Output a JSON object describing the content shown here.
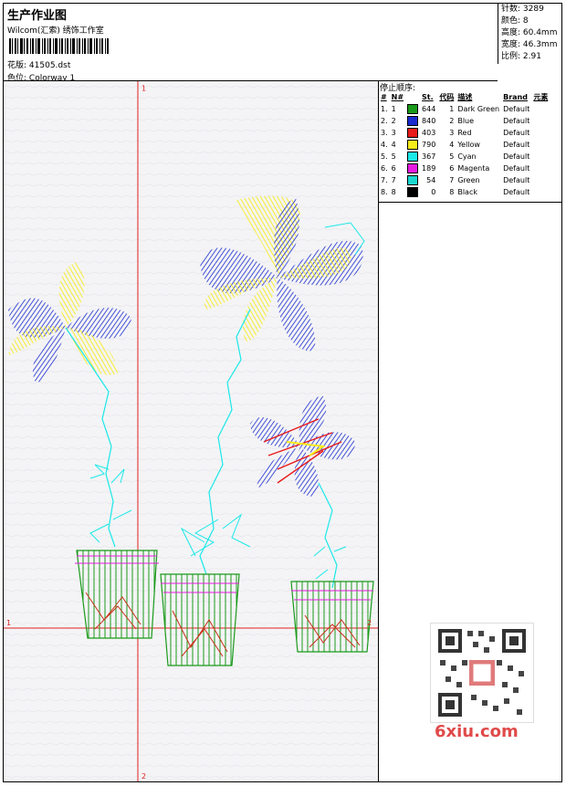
{
  "header": {
    "title": "生产作业图",
    "company": "Wilcom(汇索) 绣饰工作室",
    "file_label": "花版:",
    "file_value": "41505.dst",
    "color_label": "色位:",
    "color_value": "Colorway 1"
  },
  "info": {
    "stitches": "针数: 3289",
    "colors": "颜色: 8",
    "height": "高度: 60.4mm",
    "width": "宽度: 46.3mm",
    "scale": "比例: 2.91"
  },
  "canvas": {
    "axis_top": "1",
    "axis_left": "1",
    "axis_right": "2",
    "axis_bottom": "2"
  },
  "colors_table": {
    "stop_title": "停止顺序:",
    "headers": {
      "idx": "#",
      "n": "N#",
      "st": "St.",
      "code": "代码",
      "desc": "描述",
      "brand": "Brand",
      "elem": "元素"
    },
    "rows": [
      {
        "idx": "1.",
        "n": "1",
        "color": "#1a9a1a",
        "st": "644",
        "code": "1",
        "desc": "Dark Green",
        "brand": "Default"
      },
      {
        "idx": "2.",
        "n": "2",
        "color": "#1a2bd0",
        "st": "840",
        "code": "2",
        "desc": "Blue",
        "brand": "Default"
      },
      {
        "idx": "3.",
        "n": "3",
        "color": "#e81a1a",
        "st": "403",
        "code": "3",
        "desc": "Red",
        "brand": "Default"
      },
      {
        "idx": "4.",
        "n": "4",
        "color": "#f6ec1a",
        "st": "790",
        "code": "4",
        "desc": "Yellow",
        "brand": "Default"
      },
      {
        "idx": "5.",
        "n": "5",
        "color": "#1ae8e8",
        "st": "367",
        "code": "5",
        "desc": "Cyan",
        "brand": "Default"
      },
      {
        "idx": "6.",
        "n": "6",
        "color": "#e81ae0",
        "st": "189",
        "code": "6",
        "desc": "Magenta",
        "brand": "Default"
      },
      {
        "idx": "7.",
        "n": "7",
        "color": "#1ad8d0",
        "st": "54",
        "code": "7",
        "desc": "Green",
        "brand": "Default"
      },
      {
        "idx": "8.",
        "n": "8",
        "color": "#000000",
        "st": "0",
        "code": "8",
        "desc": "Black",
        "brand": "Default"
      }
    ]
  },
  "watermark": {
    "site": "6xiu.com"
  }
}
